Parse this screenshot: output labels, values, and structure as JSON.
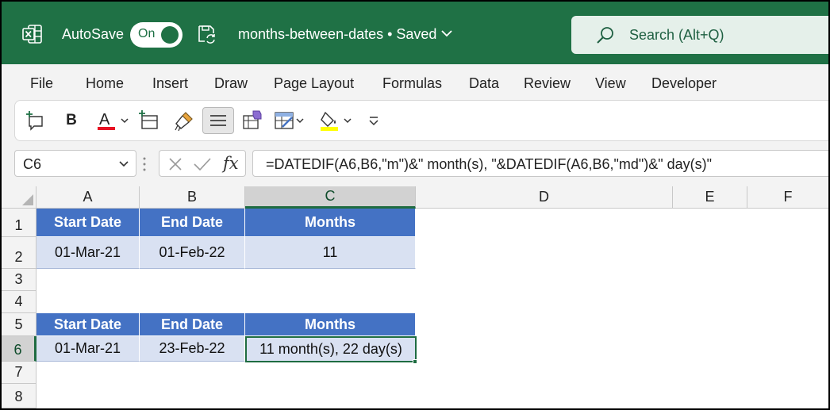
{
  "titlebar": {
    "autosave_label": "AutoSave",
    "toggle_state": "On",
    "doc_title": "months-between-dates • Saved",
    "search_placeholder": "Search (Alt+Q)"
  },
  "menu": [
    "File",
    "Home",
    "Insert",
    "Draw",
    "Page Layout",
    "Formulas",
    "Data",
    "Review",
    "View",
    "Developer"
  ],
  "toolbar": {
    "bold_label": "B",
    "font_color_label": "A",
    "colors": {
      "font_color": "#e81123",
      "highlight": "#ffff00"
    }
  },
  "formula_bar": {
    "name_box": "C6",
    "fx_label": "fx",
    "formula": "=DATEDIF(A6,B6,\"m\")&\" month(s), \"&DATEDIF(A6,B6,\"md\")&\" day(s)\""
  },
  "grid": {
    "columns": [
      "A",
      "B",
      "C",
      "D",
      "E",
      "F"
    ],
    "rows": [
      "1",
      "2",
      "3",
      "4",
      "5",
      "6",
      "7",
      "8"
    ],
    "selected_cell": "C6",
    "cells": {
      "A1": "Start Date",
      "B1": "End Date",
      "C1": "Months",
      "A2": "01-Mar-21",
      "B2": "01-Feb-22",
      "C2": "11",
      "A5": "Start Date",
      "B5": "End Date",
      "C5": "Months",
      "A6": "01-Mar-21",
      "B6": "23-Feb-22",
      "C6": "11 month(s), 22 day(s)"
    },
    "colors": {
      "header_fill": "#4472c4",
      "data_fill": "#d9e1f2",
      "selection": "#1e6c41"
    }
  }
}
